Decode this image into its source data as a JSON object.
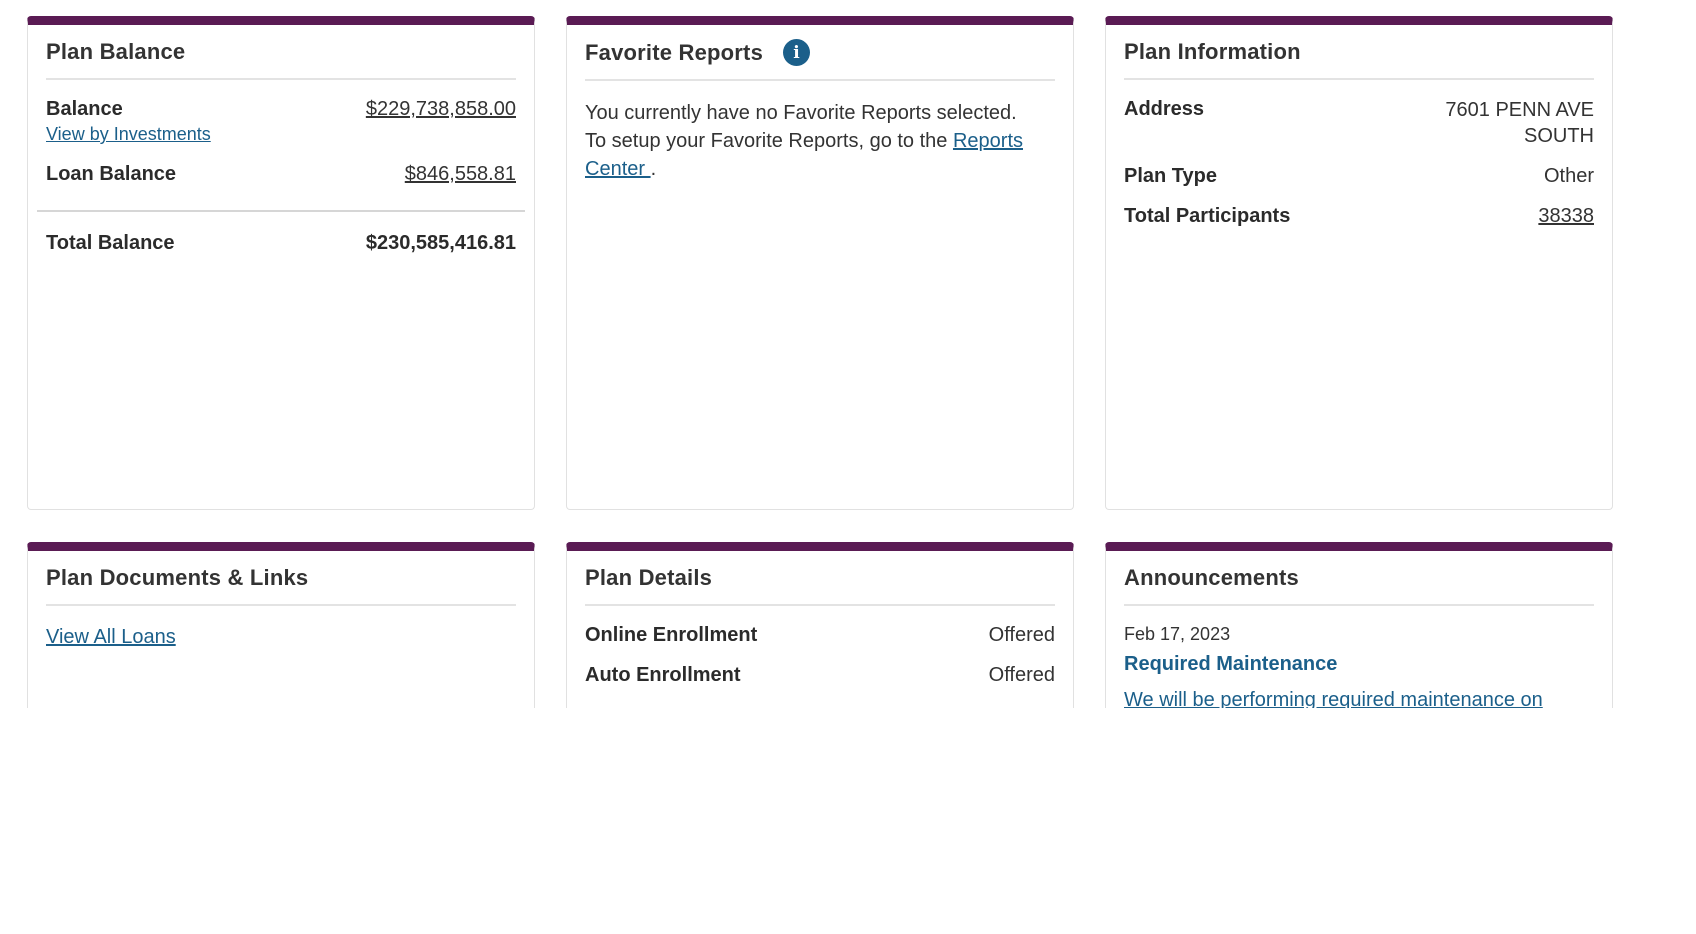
{
  "plan_balance": {
    "title": "Plan Balance",
    "balance_label": "Balance",
    "balance_value": "$229,738,858.00",
    "view_by_investments": "View by Investments",
    "loan_balance_label": "Loan Balance",
    "loan_balance_value": "$846,558.81",
    "total_balance_label": "Total Balance",
    "total_balance_value": "$230,585,416.81"
  },
  "favorite_reports": {
    "title": "Favorite Reports",
    "info_icon": "info-icon",
    "text_line1": "You currently have no Favorite Reports selected.",
    "text_line2_prefix": "To setup your Favorite Reports, go to the ",
    "reports_center_link": "Reports Center ",
    "text_suffix": "."
  },
  "plan_information": {
    "title": "Plan Information",
    "address_label": "Address",
    "address_line1": "7601 PENN AVE",
    "address_line2": "SOUTH",
    "plan_type_label": "Plan Type",
    "plan_type_value": "Other",
    "total_participants_label": "Total Participants",
    "total_participants_value": "38338"
  },
  "plan_documents": {
    "title": "Plan Documents & Links",
    "view_all_loans": "View All Loans"
  },
  "plan_details": {
    "title": "Plan Details",
    "online_enrollment_label": "Online Enrollment",
    "online_enrollment_value": "Offered",
    "auto_enrollment_label": "Auto Enrollment",
    "auto_enrollment_value": "Offered"
  },
  "announcements": {
    "title": "Announcements",
    "date": "Feb 17, 2023",
    "item_title": "Required Maintenance",
    "item_body": "We will be performing required maintenance on"
  },
  "colors": {
    "accent": "#5a1b54",
    "link": "#1b5f8a"
  }
}
